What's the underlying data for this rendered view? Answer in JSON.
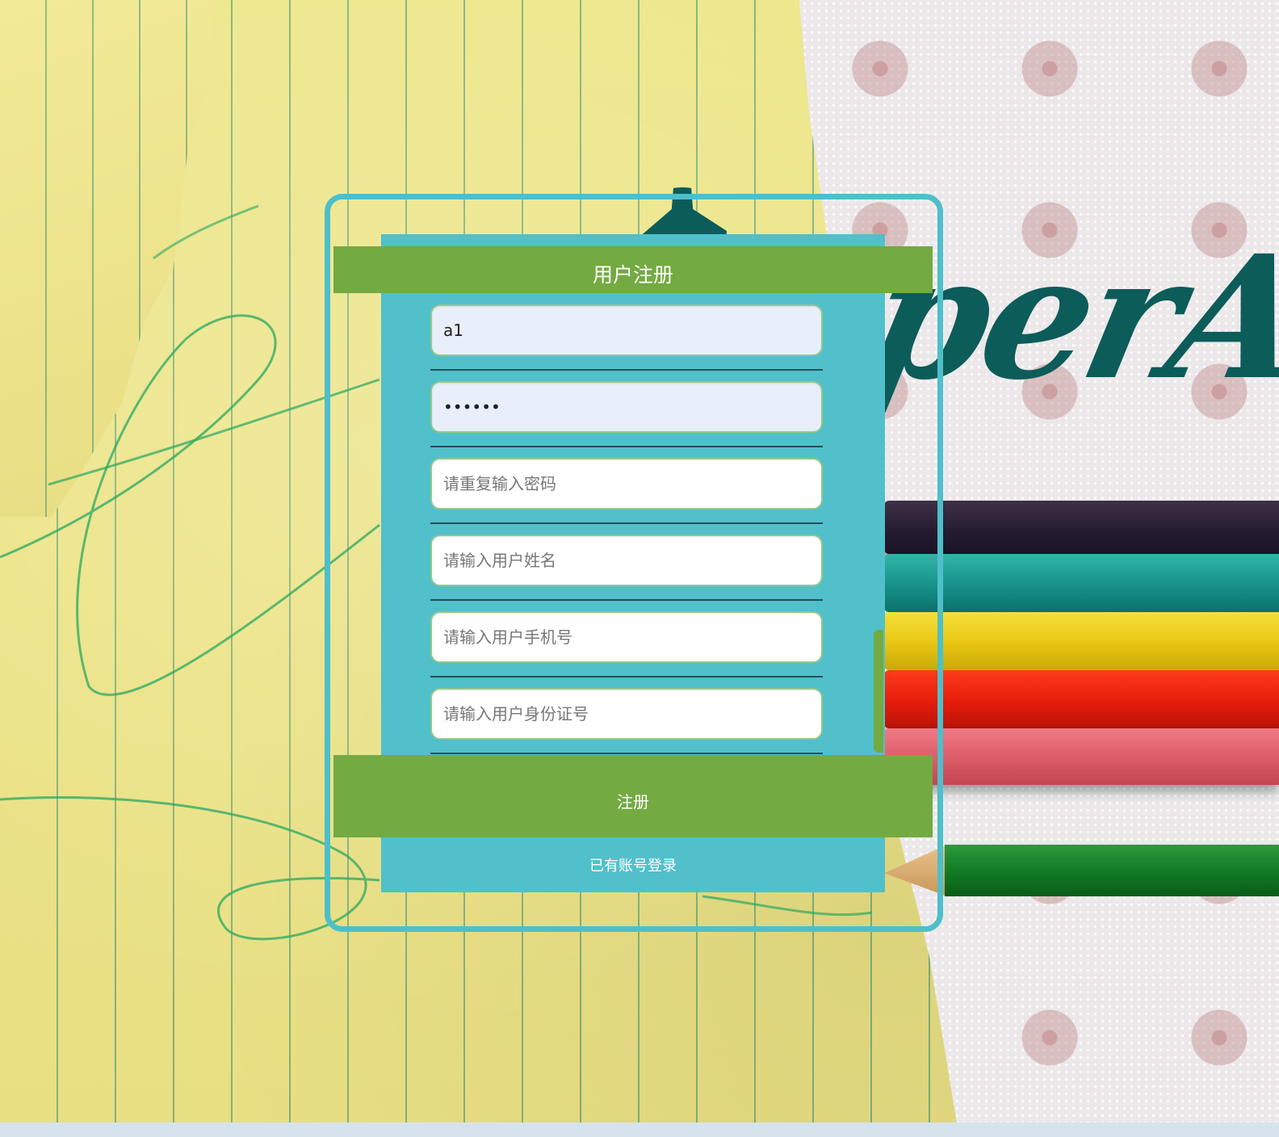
{
  "background": {
    "logo_text": "perAr"
  },
  "form": {
    "title": "用户注册",
    "fields": [
      {
        "name": "username",
        "value": "a1",
        "placeholder": ""
      },
      {
        "name": "password",
        "value": "aaaaaa",
        "placeholder": ""
      },
      {
        "name": "confirm_password",
        "value": "",
        "placeholder": "请重复输入密码"
      },
      {
        "name": "real_name",
        "value": "",
        "placeholder": "请输入用户姓名"
      },
      {
        "name": "phone",
        "value": "",
        "placeholder": "请输入用户手机号"
      },
      {
        "name": "id_number",
        "value": "",
        "placeholder": "请输入用户身份证号"
      }
    ],
    "submit_label": "注册",
    "login_link_label": "已有账号登录"
  },
  "colors": {
    "frame_border": "#4ebfc9",
    "panel": "#51c0cb",
    "accent_green": "#73aa42",
    "filled_input_bg": "#e8effb"
  }
}
